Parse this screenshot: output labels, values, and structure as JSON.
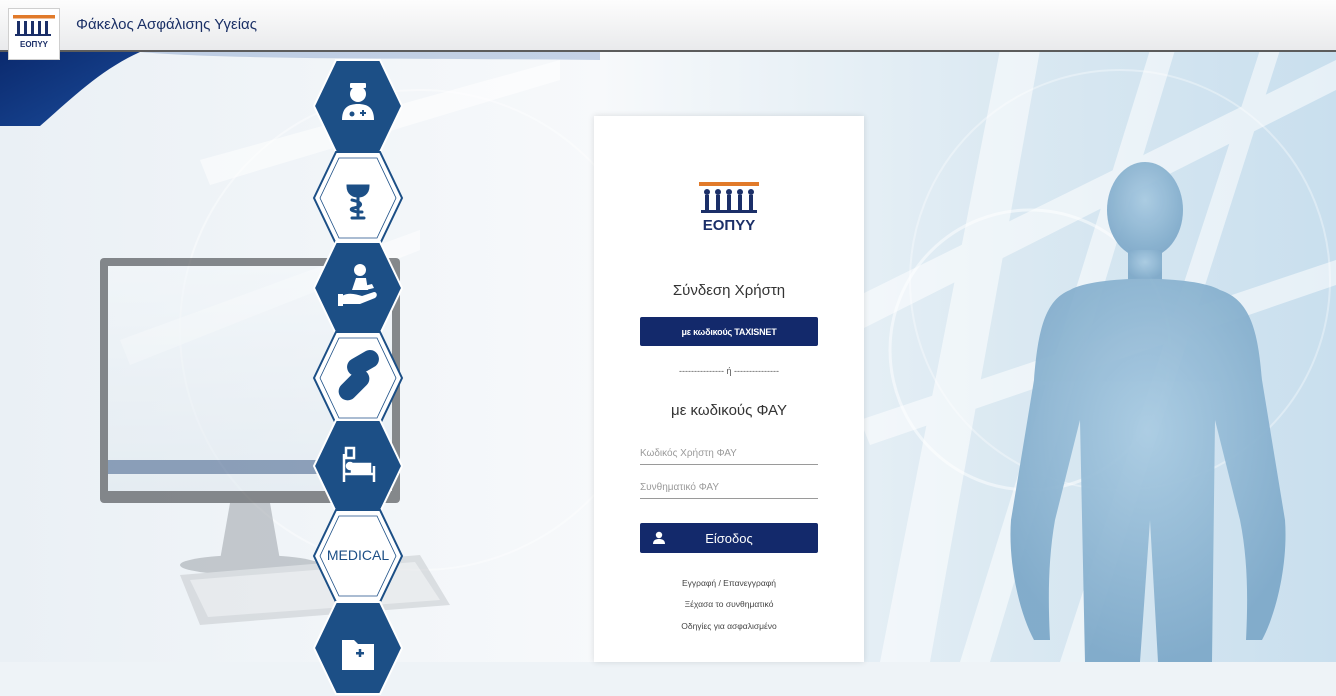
{
  "header": {
    "app_title": "Φάκελος Ασφάλισης Υγείας",
    "logo_text": "ΕΟΠΥΥ"
  },
  "login": {
    "logo_text": "ΕΟΠΥΥ",
    "heading": "Σύνδεση Χρήστη",
    "taxisnet_button": "με κωδικούς TAXISNET",
    "divider": "--------------- ή ---------------",
    "fay_heading": "με κωδικούς ΦΑΥ",
    "username_placeholder": "Κωδικός Χρήστη ΦΑΥ",
    "password_placeholder": "Συνθηματικό ΦΑΥ",
    "login_button": "Είσοδος",
    "links": [
      "Εγγραφή / Επανεγγραφή",
      "Ξέχασα το συνθηματικό",
      "Οδηγίες για ασφαλισμένο"
    ]
  },
  "side_menu": {
    "items": [
      {
        "icon": "doctor-icon",
        "style": "filled"
      },
      {
        "icon": "pharmacy-icon",
        "style": "outline"
      },
      {
        "icon": "care-icon",
        "style": "filled"
      },
      {
        "icon": "pills-icon",
        "style": "outline"
      },
      {
        "icon": "hospital-bed-icon",
        "style": "filled"
      },
      {
        "icon": "medical-text",
        "style": "outline",
        "label": "MEDICAL"
      },
      {
        "icon": "medical-folder-icon",
        "style": "filled"
      }
    ]
  },
  "colors": {
    "brand_navy": "#13296b",
    "hex_blue": "#1c4f86",
    "logo_orange": "#e17a2a",
    "logo_navy": "#1b2f68"
  }
}
